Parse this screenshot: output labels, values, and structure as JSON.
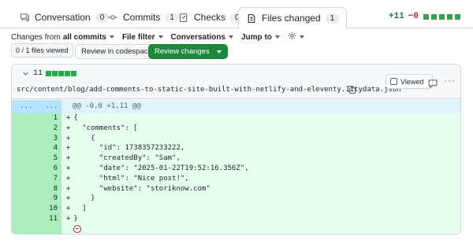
{
  "tabs": [
    {
      "label": "Conversation",
      "count": "0",
      "icon": "comment-discussion-icon"
    },
    {
      "label": "Commits",
      "count": "1",
      "icon": "git-commit-icon"
    },
    {
      "label": "Checks",
      "count": "0",
      "icon": "checklist-icon"
    },
    {
      "label": "Files changed",
      "count": "1",
      "icon": "file-diff-icon",
      "active": true
    }
  ],
  "diffstat": {
    "additions": "+11",
    "deletions": "−0"
  },
  "toolbar": {
    "changes_from_prefix": "Changes from",
    "changes_from_value": "all commits",
    "file_filter": "File filter",
    "conversations": "Conversations",
    "jump_to": "Jump to"
  },
  "files_viewed": "0 / 1 files viewed",
  "buttons": {
    "codespace": "Review in codespace",
    "review": "Review changes"
  },
  "file": {
    "change_count": "11",
    "path": "src/content/blog/add-comments-to-static-site-built-with-netlify-and-eleventy.11tydata.json",
    "viewed_label": "Viewed",
    "hunk_expand_left": "...",
    "hunk_expand_right": "...",
    "hunk_header": "@@ -0,0 +1,11 @@",
    "lines": [
      {
        "num": "1",
        "text": "{"
      },
      {
        "num": "2",
        "text": "  \"comments\": ["
      },
      {
        "num": "3",
        "text": "    {"
      },
      {
        "num": "4",
        "text": "      \"id\": 1738357233222,"
      },
      {
        "num": "5",
        "text": "      \"createdBy\": \"Sam\","
      },
      {
        "num": "6",
        "text": "      \"date\": \"2025-01-22T19:52:16.356Z\","
      },
      {
        "num": "7",
        "text": "      \"html\": \"Nice post!\","
      },
      {
        "num": "8",
        "text": "      \"website\": \"storiknow.com\""
      },
      {
        "num": "9",
        "text": "    }"
      },
      {
        "num": "10",
        "text": "  ]"
      },
      {
        "num": "11",
        "text": "}"
      }
    ]
  },
  "colors": {
    "accent_green": "#1f883d",
    "addition_bg": "#e6ffec",
    "addition_gutter": "#aceebb",
    "hunk_bg": "#ddf4ff"
  }
}
